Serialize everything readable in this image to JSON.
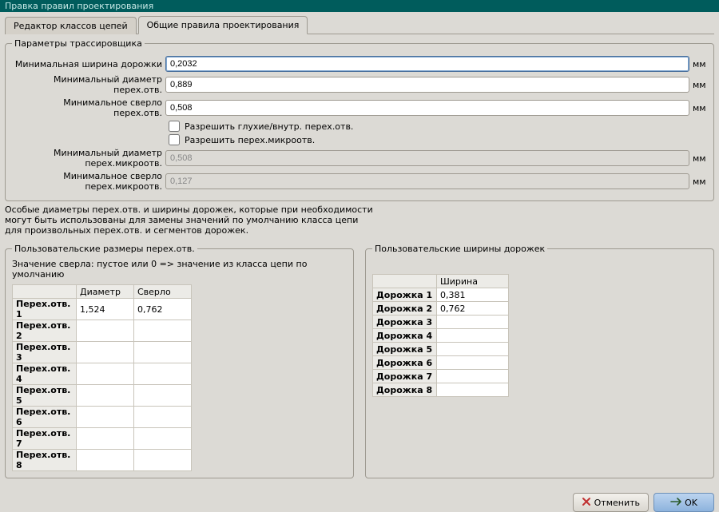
{
  "window": {
    "title": "Правка правил проектирования"
  },
  "tabs": {
    "netclass": "Редактор классов цепей",
    "general": "Общие правила проектирования"
  },
  "router_group": {
    "legend": "Параметры трассировщика",
    "unit": "мм",
    "min_track_width": {
      "label": "Минимальная ширина дорожки",
      "value": "0,2032"
    },
    "min_via_diameter": {
      "label": "Минимальный диаметр перех.отв.",
      "value": "0,889"
    },
    "min_via_drill": {
      "label": "Минимальное сверло перех.отв.",
      "value": "0,508"
    },
    "allow_blind": "Разрешить глухие/внутр. перех.отв.",
    "allow_micro": "Разрешить перех.микроотв.",
    "min_uvia_diameter": {
      "label": "Минимальный диаметр перех.микроотв.",
      "value": "0,508"
    },
    "min_uvia_drill": {
      "label": "Минимальное сверло перех.микроотв.",
      "value": "0,127"
    }
  },
  "info": {
    "line1": "Особые диаметры перех.отв. и ширины дорожек, которые при необходимости",
    "line2": "могут быть использованы для замены значений по умолчанию класса цепи",
    "line3": "для произвольных перех.отв. и сегментов дорожек."
  },
  "vias_group": {
    "legend": "Пользовательские размеры перех.отв.",
    "hint": "Значение сверла: пустое или 0 => значение из класса цепи по умолчанию",
    "col_diameter": "Диаметр",
    "col_drill": "Сверло",
    "rows": [
      {
        "head": "Перех.отв. 1",
        "dia": "1,524",
        "drill": "0,762"
      },
      {
        "head": "Перех.отв. 2",
        "dia": "",
        "drill": ""
      },
      {
        "head": "Перех.отв. 3",
        "dia": "",
        "drill": ""
      },
      {
        "head": "Перех.отв. 4",
        "dia": "",
        "drill": ""
      },
      {
        "head": "Перех.отв. 5",
        "dia": "",
        "drill": ""
      },
      {
        "head": "Перех.отв. 6",
        "dia": "",
        "drill": ""
      },
      {
        "head": "Перех.отв. 7",
        "dia": "",
        "drill": ""
      },
      {
        "head": "Перех.отв. 8",
        "dia": "",
        "drill": ""
      }
    ]
  },
  "tracks_group": {
    "legend": "Пользовательские ширины дорожек",
    "col_width": "Ширина",
    "rows": [
      {
        "head": "Дорожка 1",
        "w": "0,381"
      },
      {
        "head": "Дорожка 2",
        "w": "0,762"
      },
      {
        "head": "Дорожка 3",
        "w": ""
      },
      {
        "head": "Дорожка 4",
        "w": ""
      },
      {
        "head": "Дорожка 5",
        "w": ""
      },
      {
        "head": "Дорожка 6",
        "w": ""
      },
      {
        "head": "Дорожка 7",
        "w": ""
      },
      {
        "head": "Дорожка 8",
        "w": ""
      }
    ]
  },
  "buttons": {
    "cancel": "Отменить",
    "ok": "OK"
  }
}
